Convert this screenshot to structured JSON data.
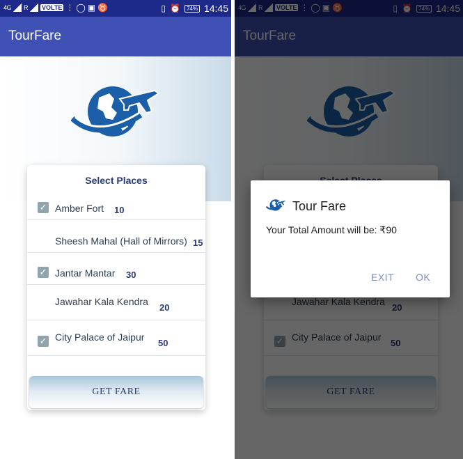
{
  "status_bar": {
    "network_label": "4G",
    "sim_label": "R",
    "volte_label": "VOLTE",
    "battery": "74%",
    "time": "14:45"
  },
  "app": {
    "title": "TourFare"
  },
  "colors": {
    "app_bar": "#3f51b5",
    "status_bar": "#1e2a8a",
    "accent_text": "#2a3a7a",
    "logo_blue": "#1a5fa8",
    "checkbox": "#90a4ae"
  },
  "card": {
    "title": "Select Places",
    "places": [
      {
        "name": "Amber Fort",
        "price": "10",
        "checked": true
      },
      {
        "name": "Sheesh Mahal (Hall of Mirrors)",
        "price": "15",
        "checked": false
      },
      {
        "name": "Jantar Mantar",
        "price": "30",
        "checked": true
      },
      {
        "name": "Jawahar Kala Kendra",
        "price": "20",
        "checked": false
      },
      {
        "name": "City Palace of Jaipur",
        "price": "50",
        "checked": true
      }
    ],
    "button_label": "GET FARE"
  },
  "dialog": {
    "title": "Tour Fare",
    "message": "Your Total Amount will be: ₹90",
    "exit_label": "EXIT",
    "ok_label": "OK"
  },
  "icons": {
    "check": "✓",
    "logo": "globe-airplane-icon"
  }
}
